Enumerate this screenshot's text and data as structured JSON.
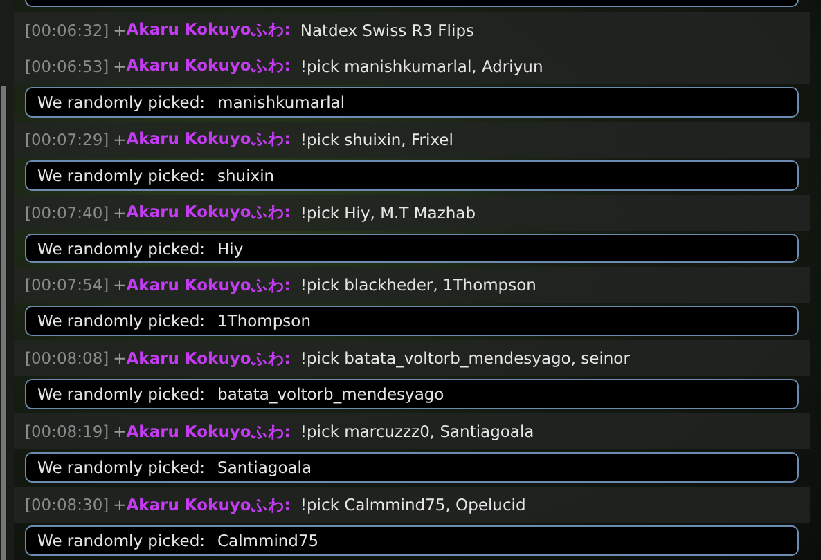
{
  "messages": [
    {
      "kind": "chat",
      "timestamp": "[00:06:32]",
      "rank": "+",
      "user": "Akaru Kokuyoふわ:",
      "text": "Natdex Swiss R3 Flips"
    },
    {
      "kind": "chat",
      "timestamp": "[00:06:53]",
      "rank": "+",
      "user": "Akaru Kokuyoふわ:",
      "text": "!pick manishkumarlal, Adriyun"
    },
    {
      "kind": "pick",
      "label": "We randomly picked:",
      "value": "manishkumarlal"
    },
    {
      "kind": "chat",
      "timestamp": "[00:07:29]",
      "rank": "+",
      "user": "Akaru Kokuyoふわ:",
      "text": "!pick shuixin, Frixel"
    },
    {
      "kind": "pick",
      "label": "We randomly picked:",
      "value": "shuixin"
    },
    {
      "kind": "chat",
      "timestamp": "[00:07:40]",
      "rank": "+",
      "user": "Akaru Kokuyoふわ:",
      "text": "!pick Hiy, M.T Mazhab"
    },
    {
      "kind": "pick",
      "label": "We randomly picked:",
      "value": "Hiy"
    },
    {
      "kind": "chat",
      "timestamp": "[00:07:54]",
      "rank": "+",
      "user": "Akaru Kokuyoふわ:",
      "text": "!pick blackheder, 1Thompson"
    },
    {
      "kind": "pick",
      "label": "We randomly picked:",
      "value": "1Thompson"
    },
    {
      "kind": "chat",
      "timestamp": "[00:08:08]",
      "rank": "+",
      "user": "Akaru Kokuyoふわ:",
      "text": "!pick batata_voltorb_mendesyago, seinor"
    },
    {
      "kind": "pick",
      "label": "We randomly picked:",
      "value": "batata_voltorb_mendesyago"
    },
    {
      "kind": "chat",
      "timestamp": "[00:08:19]",
      "rank": "+",
      "user": "Akaru Kokuyoふわ:",
      "text": "!pick marcuzzz0, Santiagoala"
    },
    {
      "kind": "pick",
      "label": "We randomly picked:",
      "value": "Santiagoala"
    },
    {
      "kind": "chat",
      "timestamp": "[00:08:30]",
      "rank": "+",
      "user": "Akaru Kokuyoふわ:",
      "text": "!pick Calmmind75, Opelucid"
    },
    {
      "kind": "pick",
      "label": "We randomly picked:",
      "value": "Calmmind75"
    }
  ]
}
